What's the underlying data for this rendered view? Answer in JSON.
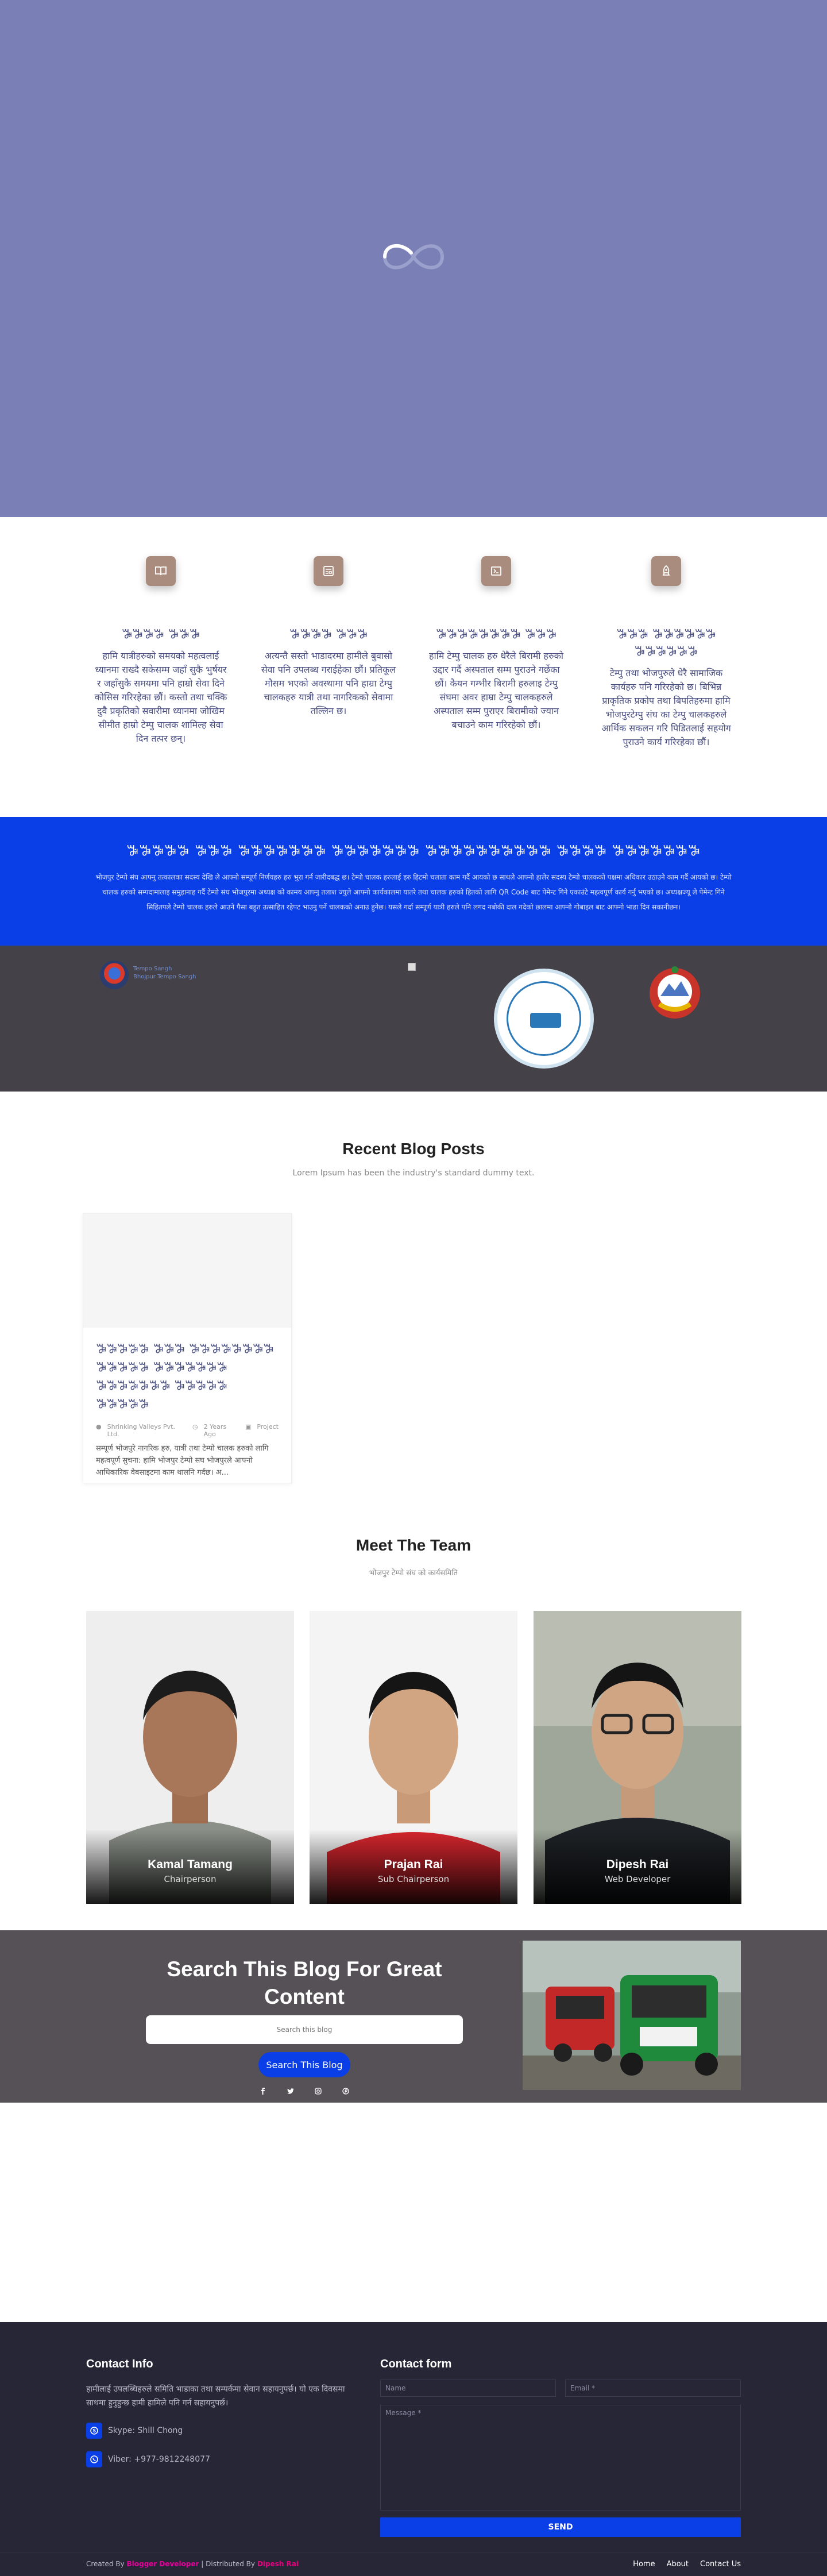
{
  "features": [
    {
      "icon": "book-open-icon",
      "title": "ꕅꕅꕅꕅ ꕅꕅꕅ",
      "text": "हामि यात्रीहरुको समयको महत्वलाई ध्यानमा राख्दै सकेसम्म जहाँ सुकै भुर्षयर र जहाँसुकै समयमा पनि हाम्रो सेवा दिने कोसिस गरिरहेका छौं। कस्तो तथा चक्कि दुवै प्रकृतिको सवारीमा ध्यानमा जोखिम सीमीत हाम्रो टेम्पु चालक शामिल्ह सेवा दिन तत्पर छन्।"
    },
    {
      "icon": "newspaper-icon",
      "title": "ꕅꕅꕅꕅ ꕅꕅꕅ",
      "text": "अत्यन्तै सस्तो भाडादरमा हामीले बुवासो सेवा पनि उपलब्ध गराईहेका छौं। प्रतिकूल मौसम भएको अवस्थामा पनि हाम्रा टेम्पु चालकहरु यात्री तथा नागरिकको सेवामा तल्लिन छ।"
    },
    {
      "icon": "ticket-icon",
      "title": "ꕅꕅꕅꕅꕅꕅꕅꕅ ꕅꕅꕅ",
      "text": "हामि टेम्पु चालक हरु धेरैले बिरामी हरुको उद्दार गर्दै अस्पताल सम्म पुराउने गर्छेका छौं। कैयन गम्भीर बिरामी हरुलाइ टेम्पु संघमा अवर हाम्रा टेम्पु चालकहरुले अस्पताल सम्म पुराएर बिरामीको ज्यान बचाउने काम गरिरहेको छौं।"
    },
    {
      "icon": "rocket-icon",
      "title": "ꕅꕅꕅ ꕅꕅꕅꕅꕅꕅ ꕅꕅꕅꕅꕅꕅ",
      "text": "टेम्पु तथा भोजपुरुले धेरै सामाजिक कार्यहरु पनि गरिरहेको छ। बिभिन्न प्राकृतिक प्रकोप तथा बिपतिहरुमा हामि भोजपुरटेम्पु संघ का टेम्पु चालकहरुले आर्थिक सकलन गरि पिडितलाई सहयोग पुराउने कार्य गरिरहेका छौं।"
    }
  ],
  "notice": {
    "title": "ꕅꕅꕅꕅꕅ ꕅꕅꕅ ꕅꕅꕅꕅꕅꕅꕅ ꕅꕅꕅꕅꕅꕅꕅ ꕅꕅꕅꕅꕅꕅꕅꕅꕅꕅ ꕅꕅꕅꕅ ꕅꕅꕅꕅꕅꕅꕅ",
    "text": "भोजपुर टेम्पो संघ आफ्नु तत्कालका सदस्य देखि ले आफ्नो सम्पूर्ण निर्णयहरु हरु भुरा गर्न जारीदबद्ध छ। टेम्पो चालक हरुलाई हरु हिटमो चलाता काम गर्दै आयको छ साथले आफ्नो हालेर सदस्य टेम्पो चालकको पक्षमा अधिकार उठाउने काम गर्दै आयको छ। टेम्पो चालक हरुको सम्पदामालाइ समुहानाह गर्दै टेम्पो संघ भोजपुरमा अध्यक्ष को कामय आफ्नु तलाश ज्युले आफ्नो कार्यकालमा यातरे तथा चालक हरुको हितको लागि QR Code बाट पेमेन्ट गिने एकाउंटे महत्वपूर्ण कार्य गर्नु भएको छ। अध्यक्षज्यू ले पेमेन्ट गिने सिहितपले टेम्पो चालक हरुले आउने पैसा बहुत उत्साहित रहेपट भाउनु पर्ने चालकको अनाउ हुनेछ। यसले गर्दा सम्पूर्ण यात्री हरुले पनि लगद नबोकी दाल गदेको छालमा आफ्नो गोबाइल बाट आफ्नो भाडा दिन सकानीछन।"
  },
  "logos": {
    "left_text_1": "Tempo Sangh",
    "left_text_2": "Bhojpur Tempo Sangh"
  },
  "blog": {
    "title": "Recent Blog Posts",
    "subtitle": "Lorem Ipsum has been the industry's standard dummy text.",
    "post": {
      "title": "ꕅꕅꕅꕅꕅ ꕅꕅꕅ ꕅꕅꕅꕅꕅꕅꕅꕅ ꕅꕅꕅꕅꕅ ꕅꕅꕅꕅꕅꕅꕅ ꕅꕅꕅꕅꕅꕅꕅ ꕅꕅꕅꕅꕅ ꕅꕅꕅꕅꕅ",
      "author": "Shrinking Valleys Pvt. Ltd.",
      "date": "2 Years Ago",
      "category": "Project",
      "excerpt": "सम्पूर्ण भोजपुरे नागरिक हरु, यात्री तथा टेम्पो चालक हरुको लागि महत्वपूर्ण सुचना: हामि भोजपुर टेम्पो सघ भोजपुरले आफ्नो आधिकारिक वेबसाइटमा काम थालनि गर्दछ। अ..."
    }
  },
  "team": {
    "title": "Meet The Team",
    "subtitle": "भोजपुर टेम्पो संघ को कार्यसमिति",
    "members": [
      {
        "name": "Kamal Tamang",
        "role": "Chairperson"
      },
      {
        "name": "Prajan Rai",
        "role": "Sub Chairperson"
      },
      {
        "name": "Dipesh Rai",
        "role": "Web Developer"
      }
    ]
  },
  "search": {
    "title": "Search This Blog For Great Content",
    "placeholder": "Search this blog",
    "button": "Search This Blog",
    "socials": [
      "facebook-icon",
      "twitter-icon",
      "instagram-icon",
      "pinterest-icon"
    ]
  },
  "contact": {
    "info_title": "Contact Info",
    "info_text": "हामीलाई उपलब्धिहरुले समिति भाडाका तथा सम्पर्कमा सेवान सहायनुपर्छ। यो एक दिवसमा साथमा हुनुहुन्छ हामी हामिले पनि गर्न सहायनुपर्छ।",
    "skype": "Skype: Shill Chong",
    "viber": "Viber: +977-9812248077",
    "form_title": "Contact form",
    "name_placeholder": "Name",
    "email_placeholder": "Email *",
    "message_placeholder": "Message *",
    "send": "SEND"
  },
  "footer": {
    "created_by": "Created By",
    "created_name": "Blogger Developer",
    "distributed_by": "| Distributed By",
    "distributed_name": "Dipesh Rai",
    "links": [
      "Home",
      "About",
      "Contact Us"
    ]
  },
  "colors": {
    "hero": "#7a80b5",
    "primary": "#0a3ee6",
    "feature_icon": "#a98c7e",
    "dark_band": "#454148",
    "footer": "#262637"
  }
}
